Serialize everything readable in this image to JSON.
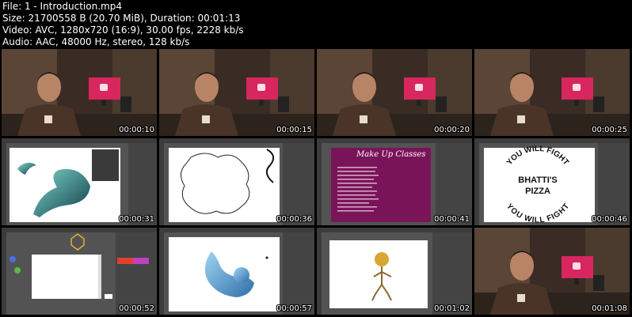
{
  "header": {
    "file_line": "File: 1 - Introduction.mp4",
    "size_line": "Size: 21700558 B (20.70 MiB), Duration: 00:01:13",
    "video_line": "Video: AVC, 1280x720 (16:9), 30.00 fps, 2228 kb/s",
    "audio_line": "Audio: AAC, 48000 Hz, stereo, 128 kb/s"
  },
  "thumbnails": [
    {
      "timestamp": "00:00:10",
      "scene": "presenter"
    },
    {
      "timestamp": "00:00:15",
      "scene": "presenter"
    },
    {
      "timestamp": "00:00:20",
      "scene": "presenter"
    },
    {
      "timestamp": "00:00:25",
      "scene": "presenter"
    },
    {
      "timestamp": "00:00:31",
      "scene": "illustrator-bird-gradient"
    },
    {
      "timestamp": "00:00:36",
      "scene": "illustrator-wavy-shape"
    },
    {
      "timestamp": "00:00:41",
      "scene": "illustrator-text-poster",
      "title": "Make Up Classes"
    },
    {
      "timestamp": "00:00:46",
      "scene": "illustrator-circular-text",
      "top_text": "YOU WILL FIGHT",
      "center_line1": "BHATTI'S",
      "center_line2": "PIZZA",
      "bottom_text": "YOU WILL FIGHT"
    },
    {
      "timestamp": "00:00:52",
      "scene": "illustrator-blank-artboard"
    },
    {
      "timestamp": "00:00:57",
      "scene": "illustrator-bird-logo"
    },
    {
      "timestamp": "00:01:02",
      "scene": "illustrator-stick-figure"
    },
    {
      "timestamp": "00:01:08",
      "scene": "presenter"
    }
  ],
  "colors": {
    "background": "#000000",
    "text": "#ffffff",
    "monitor": "#d8265e",
    "shirt": "#4a3428",
    "poster_purple": "#7a1459",
    "ai_ui_dark": "#535353"
  }
}
